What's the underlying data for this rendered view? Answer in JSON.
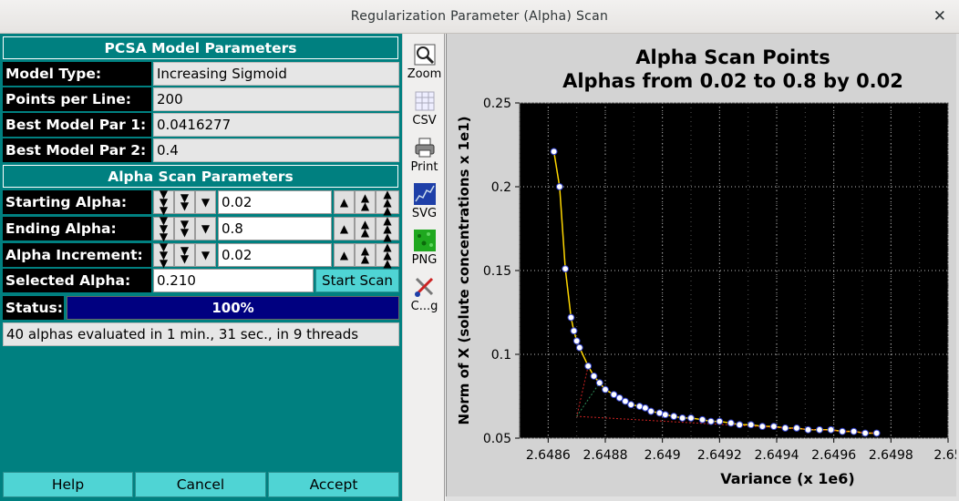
{
  "window": {
    "title": "Regularization Parameter (Alpha) Scan",
    "close_glyph": "✕"
  },
  "model_params": {
    "header": "PCSA Model Parameters",
    "rows": [
      {
        "label": "Model Type:",
        "value": "Increasing Sigmoid"
      },
      {
        "label": "Points per Line:",
        "value": "200"
      },
      {
        "label": "Best Model Par 1:",
        "value": "0.0416277"
      },
      {
        "label": "Best Model Par 2:",
        "value": "0.4"
      }
    ]
  },
  "scan_params": {
    "header": "Alpha Scan Parameters",
    "counters": [
      {
        "label": "Starting Alpha:",
        "value": "0.02"
      },
      {
        "label": "Ending Alpha:",
        "value": "0.8"
      },
      {
        "label": "Alpha Increment:",
        "value": "0.02"
      }
    ],
    "selected_label": "Selected Alpha:",
    "selected_value": "0.210",
    "start_button": "Start Scan",
    "status_label": "Status:",
    "progress_text": "100%",
    "progress_fraction": 1.0,
    "status_message": "40 alphas evaluated in 1 min., 31 sec., in 9 threads"
  },
  "buttons": {
    "help": "Help",
    "cancel": "Cancel",
    "accept": "Accept"
  },
  "toolbar": [
    {
      "label": "Zoom",
      "icon": "zoom-icon"
    },
    {
      "label": "CSV",
      "icon": "csv-icon"
    },
    {
      "label": "Print",
      "icon": "printer-icon"
    },
    {
      "label": "SVG",
      "icon": "svg-icon"
    },
    {
      "label": "PNG",
      "icon": "png-icon"
    },
    {
      "label": "C...g",
      "icon": "config-icon"
    }
  ],
  "colors": {
    "teal": "#008080",
    "button": "#4fd4d4",
    "progress": "#000080",
    "plot_bg": "#000000",
    "curve": "#ffd700",
    "corner_line": "#cc2222",
    "tangent_line": "#2e8b57"
  },
  "chart_data": {
    "type": "scatter",
    "title": "Alpha Scan Points",
    "subtitle": "Alphas from 0.02 to 0.8 by 0.02",
    "xlabel": "Variance (x 1e6)",
    "ylabel": "Norm of X (solute concentrations x 1e1)",
    "xlim": [
      2.6485,
      2.65
    ],
    "ylim": [
      0.05,
      0.25
    ],
    "xticks": [
      "2.6486",
      "2.6488",
      "2.649",
      "2.6492",
      "2.6494",
      "2.6496",
      "2.6498",
      "2.65"
    ],
    "yticks": [
      "0.05",
      "0.1",
      "0.15",
      "0.2",
      "0.25"
    ],
    "grid": true,
    "series": [
      {
        "x": [
          2.64862,
          2.64864,
          2.64866,
          2.64868,
          2.64869,
          2.6487,
          2.64871,
          2.64874,
          2.64876,
          2.64878,
          2.6488,
          2.64883,
          2.64885,
          2.64887,
          2.64889,
          2.64892,
          2.64894,
          2.64896,
          2.64899,
          2.64901,
          2.64904,
          2.64907,
          2.6491,
          2.64914,
          2.64917,
          2.6492,
          2.64924,
          2.64927,
          2.64931,
          2.64935,
          2.64939,
          2.64943,
          2.64947,
          2.64951,
          2.64955,
          2.64959,
          2.64963,
          2.64967,
          2.64971,
          2.64975
        ],
        "y": [
          0.221,
          0.2,
          0.151,
          0.122,
          0.114,
          0.108,
          0.104,
          0.093,
          0.087,
          0.083,
          0.079,
          0.076,
          0.074,
          0.072,
          0.07,
          0.069,
          0.068,
          0.066,
          0.065,
          0.064,
          0.063,
          0.062,
          0.062,
          0.061,
          0.06,
          0.06,
          0.059,
          0.058,
          0.058,
          0.057,
          0.057,
          0.056,
          0.056,
          0.055,
          0.055,
          0.055,
          0.054,
          0.054,
          0.053,
          0.053
        ]
      }
    ],
    "corner_line": {
      "x": [
        2.64874,
        2.6487,
        2.64975
      ],
      "y": [
        0.093,
        0.063,
        0.053
      ]
    },
    "selected_tangent": {
      "x": [
        2.6487,
        2.64878
      ],
      "y": [
        0.063,
        0.083
      ]
    }
  }
}
